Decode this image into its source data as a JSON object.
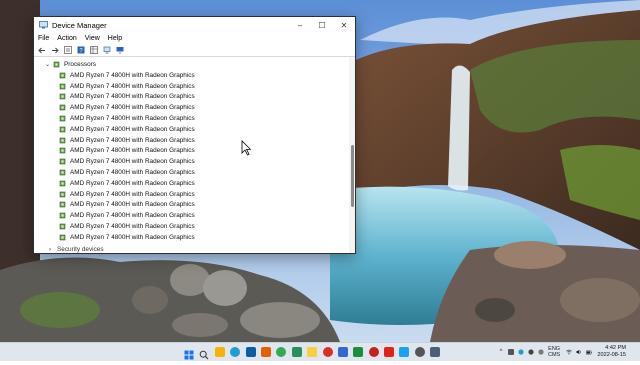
{
  "window": {
    "title": "Device Manager",
    "controls": {
      "minimize": "–",
      "maximize": "☐",
      "close": "✕"
    }
  },
  "menu": [
    "File",
    "Action",
    "View",
    "Help"
  ],
  "toolbar_icons": [
    "back-arrow-icon",
    "forward-arrow-icon",
    "properties-icon",
    "help-icon",
    "view-icon",
    "computer-icon",
    "monitor-icon"
  ],
  "tree": {
    "category": {
      "label": "Processors",
      "expanded": true,
      "expander": "⌄"
    },
    "processors": [
      "AMD Ryzen 7 4800H with Radeon Graphics",
      "AMD Ryzen 7 4800H with Radeon Graphics",
      "AMD Ryzen 7 4800H with Radeon Graphics",
      "AMD Ryzen 7 4800H with Radeon Graphics",
      "AMD Ryzen 7 4800H with Radeon Graphics",
      "AMD Ryzen 7 4800H with Radeon Graphics",
      "AMD Ryzen 7 4800H with Radeon Graphics",
      "AMD Ryzen 7 4800H with Radeon Graphics",
      "AMD Ryzen 7 4800H with Radeon Graphics",
      "AMD Ryzen 7 4800H with Radeon Graphics",
      "AMD Ryzen 7 4800H with Radeon Graphics",
      "AMD Ryzen 7 4800H with Radeon Graphics",
      "AMD Ryzen 7 4800H with Radeon Graphics",
      "AMD Ryzen 7 4800H with Radeon Graphics",
      "AMD Ryzen 7 4800H with Radeon Graphics",
      "AMD Ryzen 7 4800H with Radeon Graphics"
    ],
    "next_category_partial": "Security devices"
  },
  "taskbar": {
    "icons": [
      {
        "name": "start-icon",
        "color": "#1a73e8"
      },
      {
        "name": "search-icon",
        "color": "#333333"
      },
      {
        "name": "file-explorer-icon",
        "color": "#f4b400"
      },
      {
        "name": "edge-icon",
        "color": "#1f9bd6"
      },
      {
        "name": "store-icon",
        "color": "#0a5ea8"
      },
      {
        "name": "firefox-icon",
        "color": "#e66000"
      },
      {
        "name": "chrome-icon",
        "color": "#34a853"
      },
      {
        "name": "edge-beta-icon",
        "color": "#2a8f5c"
      },
      {
        "name": "notes-icon",
        "color": "#f9d03b"
      },
      {
        "name": "app-icon-red",
        "color": "#d93025"
      },
      {
        "name": "app-icon-blue",
        "color": "#3367d6"
      },
      {
        "name": "chrome-alt-icon",
        "color": "#1e8e3e"
      },
      {
        "name": "photos-icon",
        "color": "#c5221f"
      },
      {
        "name": "youtube-icon",
        "color": "#e62117"
      },
      {
        "name": "twitter-icon",
        "color": "#1da1f2"
      },
      {
        "name": "settings-icon",
        "color": "#555555"
      },
      {
        "name": "device-manager-icon",
        "color": "#4a6078"
      }
    ],
    "tray": {
      "chevron": "^",
      "lang_top": "ENG",
      "lang_bottom": "CMS",
      "time": "4:42 PM",
      "date": "2022-08-15"
    }
  },
  "colors": {
    "accent": "#1a73e8",
    "taskbar": "#dfe6ee"
  }
}
